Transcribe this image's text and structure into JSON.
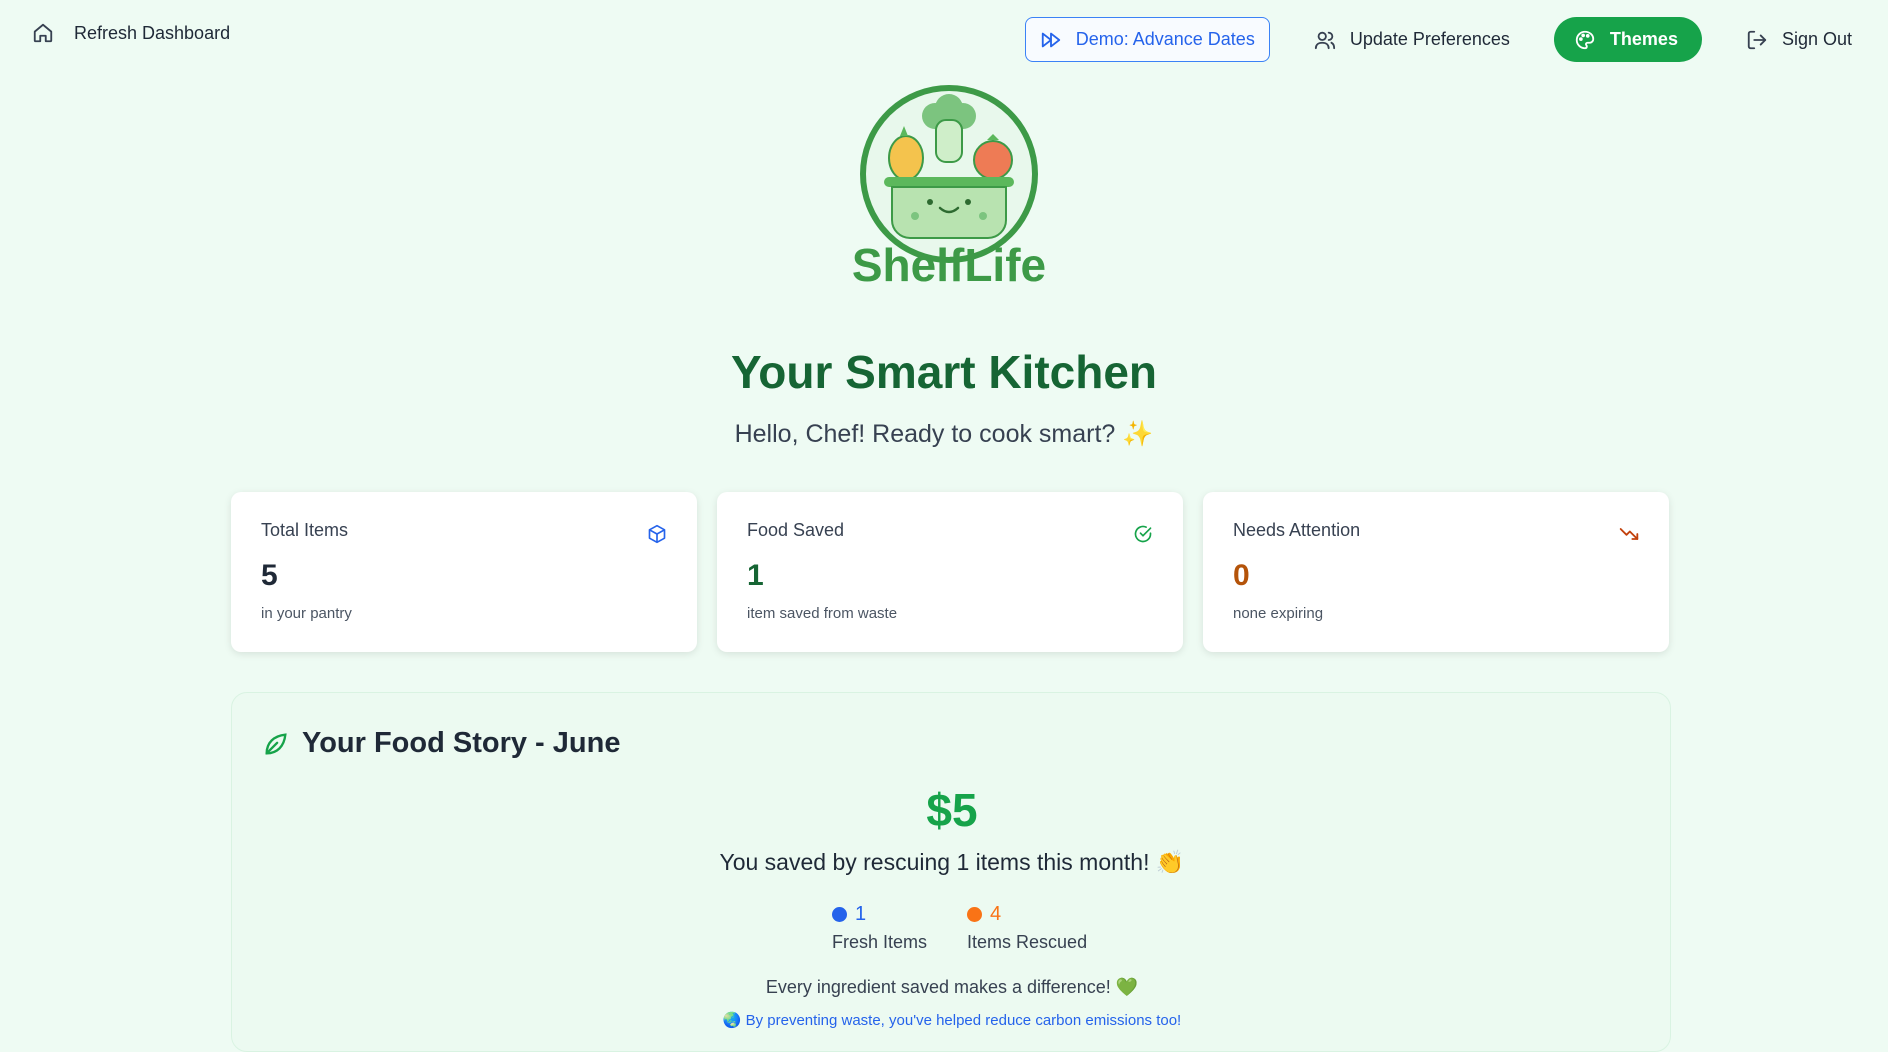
{
  "nav": {
    "refresh_label": "Refresh Dashboard",
    "demo_label": "Demo: Advance Dates",
    "preferences_label": "Update Preferences",
    "themes_label": "Themes",
    "signout_label": "Sign Out"
  },
  "brand": {
    "name": "ShelfLife"
  },
  "header": {
    "title": "Your Smart Kitchen",
    "subtitle": "Hello, Chef! Ready to cook smart? ✨"
  },
  "cards": [
    {
      "label": "Total Items",
      "value": "5",
      "sub": "in your pantry",
      "icon": "package-icon",
      "color": "#1f2937"
    },
    {
      "label": "Food Saved",
      "value": "1",
      "sub": "item saved from waste",
      "icon": "check-circle-icon",
      "color": "#166534"
    },
    {
      "label": "Needs Attention",
      "value": "0",
      "sub": "none expiring",
      "icon": "trending-down-icon",
      "color": "#b45309"
    }
  ],
  "story": {
    "title": "Your Food Story - June",
    "amount": "$5",
    "saved_line": "You saved by rescuing 1 items this month! 👏",
    "stats": [
      {
        "value": "1",
        "label": "Fresh Items",
        "color": "#2563eb"
      },
      {
        "value": "4",
        "label": "Items Rescued",
        "color": "#f97316"
      }
    ],
    "difference": "Every ingredient saved makes a difference! 💚",
    "carbon": "🌏 By preventing waste, you've helped reduce carbon emissions too!"
  },
  "colors": {
    "accent": "#16a34a",
    "title": "#166534",
    "link": "#2563eb"
  }
}
